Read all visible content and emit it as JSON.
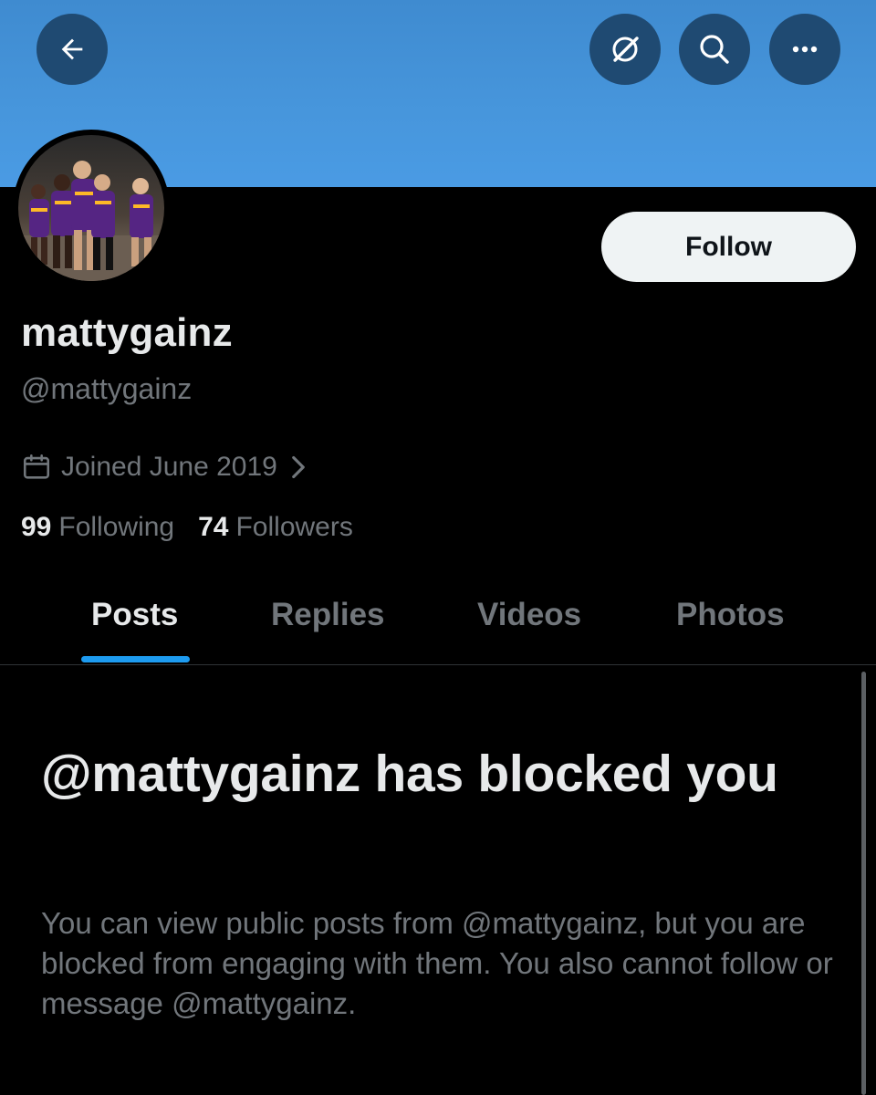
{
  "header": {
    "back_icon": "arrow-left-icon",
    "grok_icon": "grok-icon",
    "search_icon": "search-icon",
    "more_icon": "more-horizontal-icon",
    "banner_color": "#4796dc",
    "button_color": "#1f4a72"
  },
  "profile": {
    "display_name": "mattygainz",
    "handle": "@mattygainz",
    "joined": "Joined June 2019",
    "calendar_icon": "calendar-icon",
    "chevron_icon": "chevron-right-icon",
    "follow_label": "Follow",
    "following_count": "99",
    "following_label": "Following",
    "followers_count": "74",
    "followers_label": "Followers"
  },
  "tabs": [
    {
      "label": "Posts",
      "active": true
    },
    {
      "label": "Replies",
      "active": false
    },
    {
      "label": "Videos",
      "active": false
    },
    {
      "label": "Photos",
      "active": false
    }
  ],
  "accent_color": "#1d9bf0",
  "blocked": {
    "title": "@mattygainz has blocked you",
    "description": "You can view public posts from @mattygainz, but you are blocked from engaging with them. You also cannot follow or message @mattygainz."
  }
}
